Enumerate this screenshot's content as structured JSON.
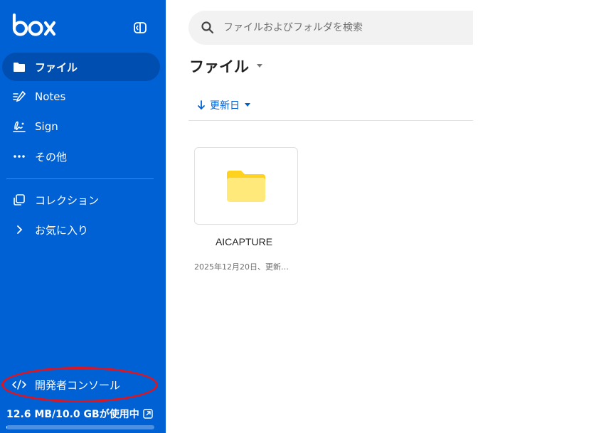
{
  "sidebar": {
    "logo": "box",
    "nav_items": [
      {
        "label": "ファイル",
        "icon": "folder-icon",
        "active": true
      },
      {
        "label": "Notes",
        "icon": "notes-icon",
        "active": false
      },
      {
        "label": "Sign",
        "icon": "sign-icon",
        "active": false
      },
      {
        "label": "その他",
        "icon": "more-icon",
        "active": false
      }
    ],
    "secondary_items": [
      {
        "label": "コレクション",
        "icon": "collections-icon"
      },
      {
        "label": "お気に入り",
        "icon": "chevron-right-icon"
      }
    ],
    "dev_console": {
      "label": "開発者コンソール",
      "icon": "code-icon"
    },
    "storage": {
      "label": "12.6 MB/10.0 GBが使用中",
      "used_fraction": 0.00126
    },
    "colors": {
      "background": "#0061d5",
      "active": "#004fb0",
      "highlight_oval": "#e0141e"
    }
  },
  "search": {
    "placeholder": "ファイルおよびフォルダを検索"
  },
  "main": {
    "title": "ファイル",
    "sort": {
      "label": "更新日",
      "direction": "descending"
    },
    "items": [
      {
        "name": "AICAPTURE",
        "meta": "2025年12月20日、更新…",
        "type": "folder",
        "folder_color": "#ffd21f"
      }
    ]
  }
}
